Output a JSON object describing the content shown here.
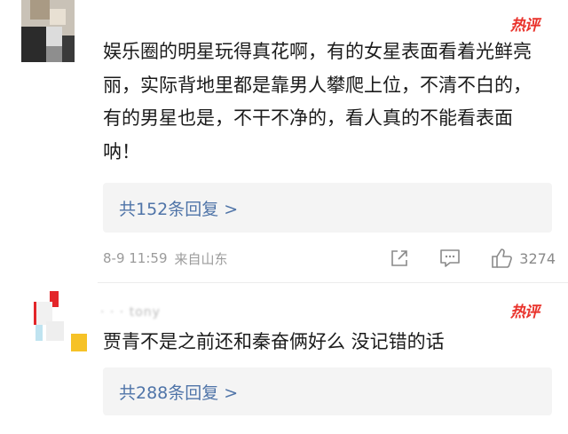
{
  "comments": [
    {
      "hot_label": "热评",
      "text": "娱乐圈的明星玩得真花啊，有的女星表面看着光鲜亮丽，实际背地里都是靠男人攀爬上位，不清不白的，有的男星也是，不干不净的，看人真的不能看表面呐！",
      "reply_label": "共152条回复 >",
      "timestamp": "8-9 11:59",
      "location": "来自山东",
      "likes": "3274"
    },
    {
      "hot_label": "热评",
      "username": "· · · tony",
      "text": "贾青不是之前还和秦奋俩好么 没记错的话",
      "reply_label": "共288条回复 >"
    }
  ],
  "icons": [
    "share-icon",
    "comment-icon",
    "like-icon"
  ],
  "colors": {
    "hot": "#e9322b",
    "link": "#4f74a8",
    "meta": "#9b9b9b"
  }
}
